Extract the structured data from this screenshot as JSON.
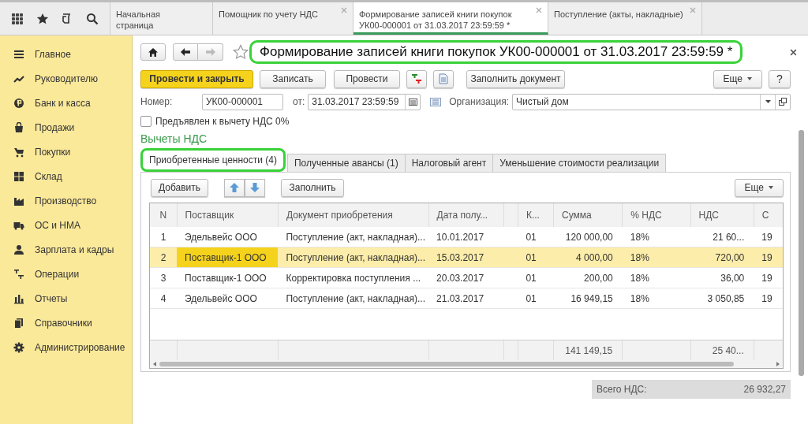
{
  "tabs": [
    {
      "label": "Начальная страница",
      "selected": false,
      "closable": false
    },
    {
      "label": "Помощник по учету НДС",
      "selected": false,
      "closable": true
    },
    {
      "label": "Формирование записей книги покупок УК00-000001 от 31.03.2017 23:59:59 *",
      "selected": true,
      "closable": true
    },
    {
      "label": "Поступление (акты, накладные)",
      "selected": false,
      "closable": true
    }
  ],
  "sidebar": {
    "items": [
      {
        "label": "Главное"
      },
      {
        "label": "Руководителю"
      },
      {
        "label": "Банк и касса"
      },
      {
        "label": "Продажи"
      },
      {
        "label": "Покупки"
      },
      {
        "label": "Склад"
      },
      {
        "label": "Производство"
      },
      {
        "label": "ОС и НМА"
      },
      {
        "label": "Зарплата и кадры"
      },
      {
        "label": "Операции"
      },
      {
        "label": "Отчеты"
      },
      {
        "label": "Справочники"
      },
      {
        "label": "Администрирование"
      }
    ]
  },
  "document": {
    "title": "Формирование записей книги покупок УК00-000001 от 31.03.2017 23:59:59 *",
    "favorite": false,
    "buttons": {
      "post_close": "Провести и закрыть",
      "save": "Записать",
      "post": "Провести",
      "fill": "Заполнить документ",
      "more": "Еще",
      "help": "?"
    },
    "number_label": "Номер:",
    "number": "УК00-000001",
    "date_label": "от:",
    "date": "31.03.2017 23:59:59",
    "org_label": "Организация:",
    "org": "Чистый дом",
    "checkbox": {
      "label": "Предъявлен к вычету НДС 0%",
      "checked": false
    },
    "section_title": "Вычеты НДС",
    "inner_tabs": [
      {
        "label": "Приобретенные ценности (4)",
        "selected": true
      },
      {
        "label": "Полученные авансы (1)",
        "selected": false
      },
      {
        "label": "Налоговый агент",
        "selected": false
      },
      {
        "label": "Уменьшение стоимости реализации",
        "selected": false
      }
    ],
    "table_toolbar": {
      "add": "Добавить",
      "fill": "Заполнить",
      "more": "Еще"
    },
    "table": {
      "columns": [
        "N",
        "Поставщик",
        "Документ приобретения",
        "Дата полу...",
        "",
        "К...",
        "Сумма",
        "% НДС",
        "НДС",
        "С"
      ],
      "rows": [
        {
          "selected": false,
          "cells": [
            "1",
            "Эдельвейс ООО",
            "Поступление (акт, накладная)...",
            "10.01.2017",
            "",
            "01",
            "120 000,00",
            "18%",
            "21 60...",
            "19"
          ]
        },
        {
          "selected": true,
          "cells": [
            "2",
            "Поставщик-1 ООО",
            "Поступление (акт, накладная)...",
            "15.03.2017",
            "",
            "01",
            "4 000,00",
            "18%",
            "720,00",
            "19"
          ]
        },
        {
          "selected": false,
          "cells": [
            "3",
            "Поставщик-1 ООО",
            "Корректировка поступления ...",
            "20.03.2017",
            "",
            "01",
            "200,00",
            "18%",
            "36,00",
            "19"
          ]
        },
        {
          "selected": false,
          "cells": [
            "4",
            "Эдельвейс ООО",
            "Поступление (акт, накладная)...",
            "21.03.2017",
            "",
            "01",
            "16 949,15",
            "18%",
            "3 050,85",
            "19"
          ]
        }
      ],
      "footer": {
        "amount": "141 149,15",
        "vat": "25 40..."
      }
    },
    "total": {
      "label": "Всего НДС:",
      "value": "26 932,27"
    }
  }
}
